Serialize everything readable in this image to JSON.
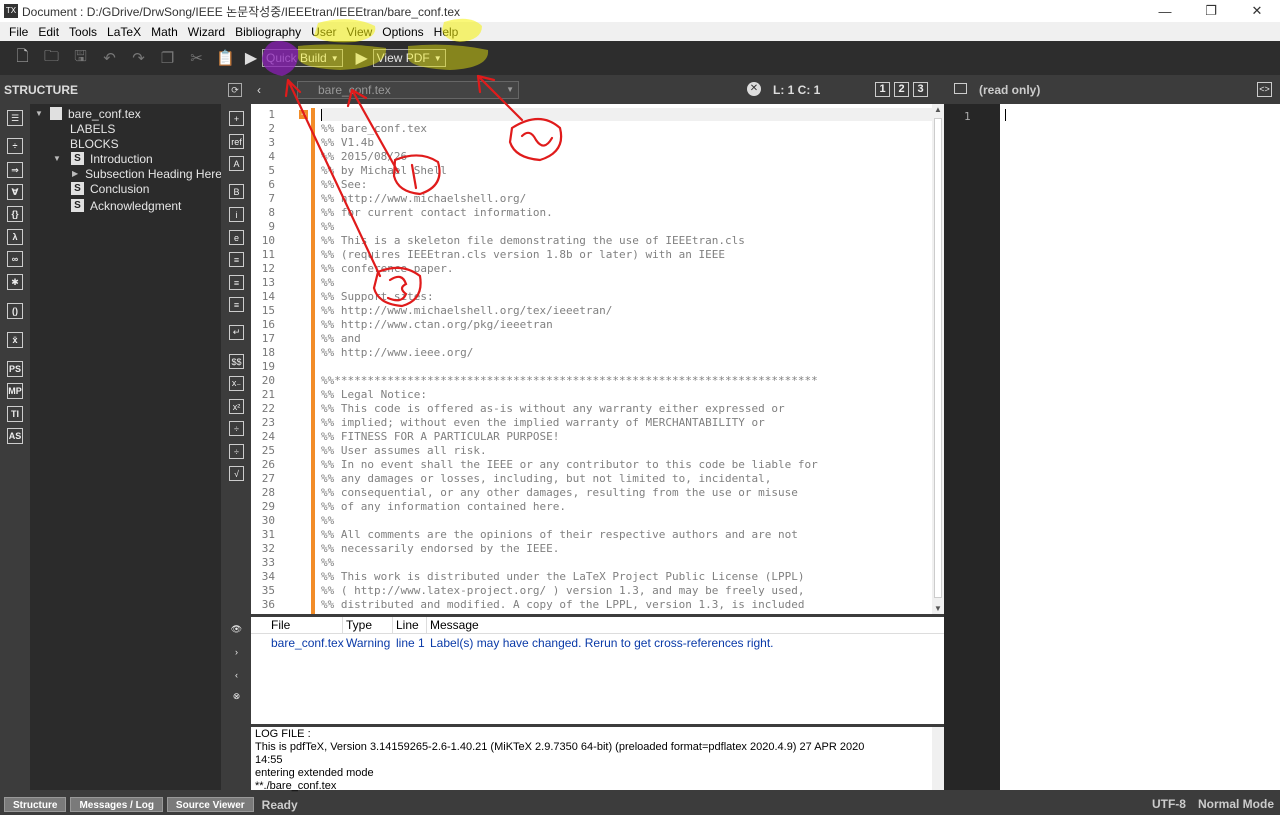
{
  "window": {
    "title": "Document : D:/GDrive/DrwSong/IEEE 논문작성중/IEEEtran/IEEEtran/bare_conf.tex",
    "minimize": "—",
    "maximize": "❐",
    "close": "✕"
  },
  "menu": [
    "File",
    "Edit",
    "Tools",
    "LaTeX",
    "Math",
    "Wizard",
    "Bibliography",
    "User",
    "View",
    "Options",
    "Help"
  ],
  "toolbar": {
    "build_label": "Quick Build",
    "view_label": "View PDF"
  },
  "structure": {
    "header": "STRUCTURE",
    "file": "bare_conf.tex",
    "labels": "LABELS",
    "blocks": "BLOCKS",
    "section_intro": "Introduction",
    "subsection": "Subsection Heading Here",
    "section_conclusion": "Conclusion",
    "section_ack": "Acknowledgment"
  },
  "editor": {
    "tab_name": "bare_conf.tex",
    "cursor_pos": "L: 1 C: 1",
    "view_1": "1",
    "view_2": "2",
    "view_3": "3",
    "line_numbers": [
      "1",
      "2",
      "3",
      "4",
      "5",
      "6",
      "7",
      "8",
      "9",
      "10",
      "11",
      "12",
      "13",
      "14",
      "15",
      "16",
      "17",
      "18",
      "19",
      "20",
      "21",
      "22",
      "23",
      "24",
      "25",
      "26",
      "27",
      "28",
      "29",
      "30",
      "31",
      "32",
      "33",
      "34",
      "35",
      "36"
    ],
    "lines": [
      "",
      "%% bare_conf.tex",
      "%% V1.4b",
      "%% 2015/08/26",
      "%% by Michael Shell",
      "%% See:",
      "%% http://www.michaelshell.org/",
      "%% for current contact information.",
      "%%",
      "%% This is a skeleton file demonstrating the use of IEEEtran.cls",
      "%% (requires IEEEtran.cls version 1.8b or later) with an IEEE",
      "%% conference paper.",
      "%%",
      "%% Support sites:",
      "%% http://www.michaelshell.org/tex/ieeetran/",
      "%% http://www.ctan.org/pkg/ieeetran",
      "%% and",
      "%% http://www.ieee.org/",
      "",
      "%%*************************************************************************",
      "%% Legal Notice:",
      "%% This code is offered as-is without any warranty either expressed or",
      "%% implied; without even the implied warranty of MERCHANTABILITY or",
      "%% FITNESS FOR A PARTICULAR PURPOSE!",
      "%% User assumes all risk.",
      "%% In no event shall the IEEE or any contributor to this code be liable for",
      "%% any damages or losses, including, but not limited to, incidental,",
      "%% consequential, or any other damages, resulting from the use or misuse",
      "%% of any information contained here.",
      "%%",
      "%% All comments are the opinions of their respective authors and are not",
      "%% necessarily endorsed by the IEEE.",
      "%%",
      "%% This work is distributed under the LaTeX Project Public License (LPPL)",
      "%% ( http://www.latex-project.org/ ) version 1.3, and may be freely used,",
      "%% distributed and modified. A copy of the LPPL, version 1.3, is included"
    ]
  },
  "messages": {
    "headers": [
      "File",
      "Type",
      "Line",
      "Message"
    ],
    "row": [
      "bare_conf.tex",
      "Warning",
      "line 1",
      "Label(s) may have changed. Rerun to get cross-references right."
    ]
  },
  "log": {
    "lines": [
      "LOG FILE :",
      "This is pdfTeX, Version 3.14159265-2.6-1.40.21 (MiKTeX 2.9.7350 64-bit) (preloaded format=pdflatex 2020.4.9) 27 APR 2020",
      "14:55",
      "entering extended mode",
      "**./bare_conf.tex"
    ]
  },
  "preview": {
    "status": "(read only)",
    "line": "1"
  },
  "statusbar": {
    "structure": "Structure",
    "messages": "Messages / Log",
    "source_viewer": "Source Viewer",
    "ready": "Ready",
    "encoding": "UTF-8",
    "mode": "Normal Mode"
  },
  "annotations": {
    "colors": {
      "red": "#e01b1b",
      "yellow": "#f5f20a",
      "purple": "#8a1fb5"
    }
  }
}
